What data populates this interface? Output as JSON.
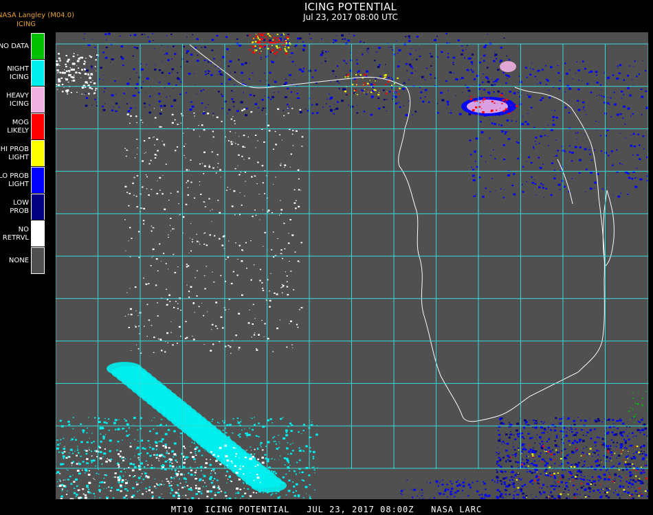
{
  "header": {
    "source": "NASA Langley (M04.0)",
    "product": "ICING",
    "title": "ICING POTENTIAL",
    "subtitle": "Jul 23, 2017 08:00 UTC"
  },
  "legend": {
    "items": [
      {
        "label": "NO DATA",
        "color": "#00c000"
      },
      {
        "label": "NIGHT\nICING",
        "color": "#00f0f0"
      },
      {
        "label": "HEAVY\nICING",
        "color": "#f0b0e0"
      },
      {
        "label": "MOG\nLIKELY",
        "color": "#ff0000"
      },
      {
        "label": "HI PROB\nLIGHT",
        "color": "#ffff00"
      },
      {
        "label": "LO PROB\nLIGHT",
        "color": "#0000ff"
      },
      {
        "label": "LOW\nPROB",
        "color": "#000080"
      },
      {
        "label": "NO\nRETRVL",
        "color": "#ffffff"
      },
      {
        "label": "NONE",
        "color": "#505050"
      }
    ]
  },
  "map": {
    "background_color": "#505050",
    "grid_color": "#33dddd",
    "coast_color": "#ffffff"
  },
  "footer": {
    "text": "MT10  ICING POTENTIAL   JUL 23, 2017 08:00Z   NASA LARC"
  }
}
